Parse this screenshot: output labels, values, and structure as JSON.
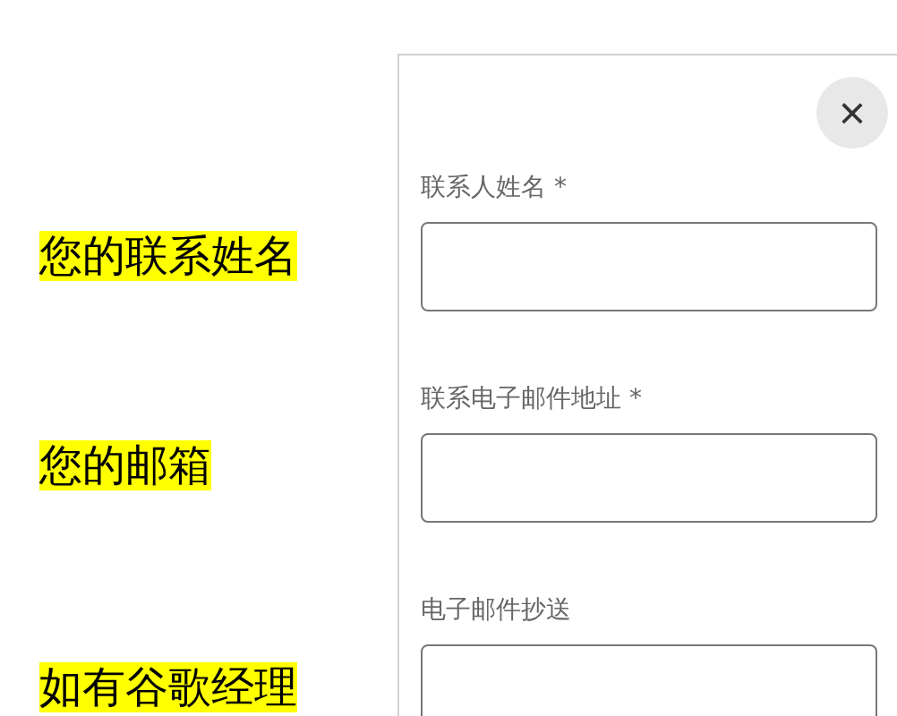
{
  "annotations": [
    "您的联系姓名",
    "您的邮箱",
    "如有谷歌经理"
  ],
  "dialog": {
    "close_button": "×",
    "fields": [
      {
        "label": "联系人姓名 *"
      },
      {
        "label": "联系电子邮件地址 *"
      },
      {
        "label": "电子邮件抄送"
      }
    ]
  }
}
